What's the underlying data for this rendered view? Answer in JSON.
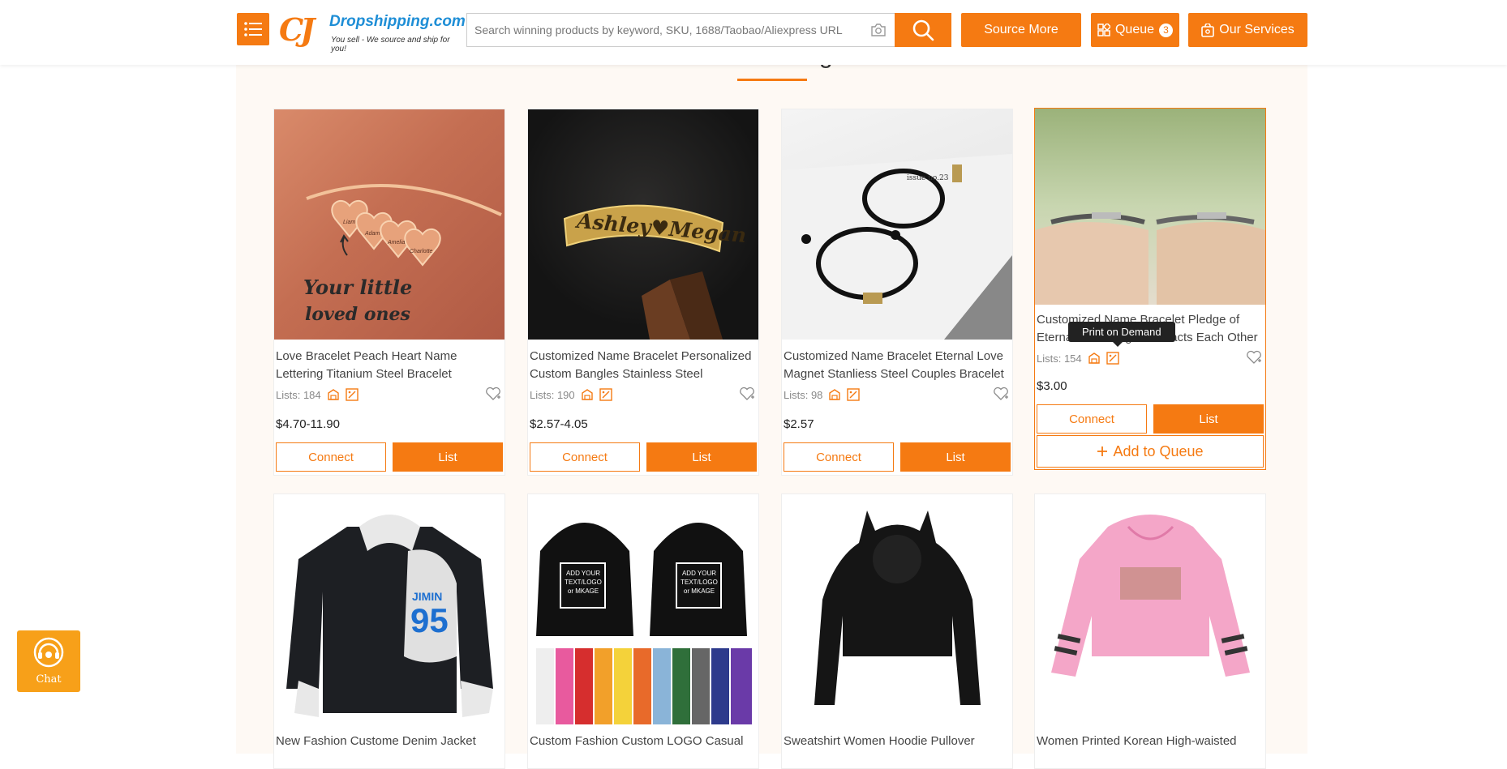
{
  "header": {
    "logo_brand": "Dropshipping.com",
    "logo_tagline": "You sell - We source and ship for you!",
    "search_placeholder": "Search winning products by keyword, SKU, 1688/Taobao/Aliexpress URL",
    "source_more": "Source More",
    "queue_label": "Queue",
    "queue_count": "3",
    "our_services": "Our Services"
  },
  "section": {
    "title_fragment": "g"
  },
  "tooltip": "Print on Demand",
  "chat_label": "Chat",
  "labels": {
    "connect": "Connect",
    "list": "List",
    "add_to_queue": "Add to Queue"
  },
  "products": [
    {
      "title": "Love Bracelet Peach Heart Name Lettering Titanium Steel Bracelet",
      "lists": "Lists: 184",
      "price": "$4.70-11.90"
    },
    {
      "title": "Customized Name Bracelet Personalized Custom Bangles Stainless Steel",
      "lists": "Lists: 190",
      "price": "$2.57-4.05"
    },
    {
      "title": "Customized Name Bracelet Eternal Love Magnet Stanliess Steel Couples Bracelet",
      "lists": "Lists: 98",
      "price": "$2.57"
    },
    {
      "title": "Customized Name Bracelet Pledge of Eternal Love Magnet Attracts Each Other",
      "lists": "Lists: 154",
      "price": "$3.00"
    },
    {
      "title": "New Fashion Custome Denim Jacket"
    },
    {
      "title": "Custom Fashion Custom LOGO Casual"
    },
    {
      "title": "Sweatshirt Women Hoodie Pullover"
    },
    {
      "title": "Women Printed Korean High-waisted"
    }
  ],
  "image_text": {
    "p1_a": "Your little",
    "p1_b": "loved ones",
    "p1_names": [
      "Liam",
      "Adam",
      "Amelia",
      "Charlotte"
    ],
    "p2": "Ashley♥Megan",
    "p3": "issue no.23",
    "p5": "95",
    "p5_name": "JIMIN",
    "p6": "ADD YOUR TEXT/LOGO or MKAGE"
  },
  "colors": {
    "accent": "#f57a12",
    "panel_bg": "#fef9f4",
    "brand_blue": "#1e8ed6"
  }
}
